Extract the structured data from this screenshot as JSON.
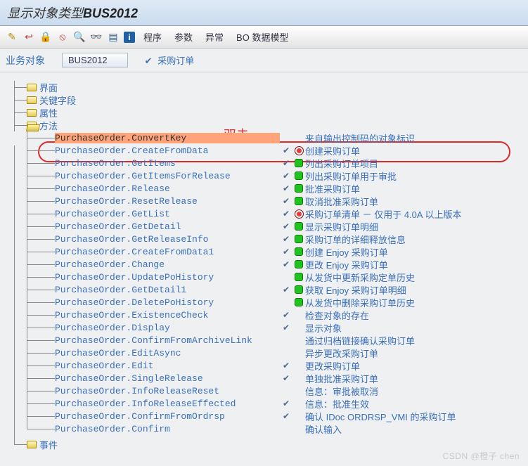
{
  "titlebar": {
    "prefix": "显示对象类型",
    "objtype": "BUS2012"
  },
  "toolbar": {
    "icons": [
      "wand",
      "brush",
      "lock",
      "stop",
      "find",
      "findnext",
      "grid",
      "info"
    ],
    "menus": {
      "program": "程序",
      "params": "参数",
      "except": "异常",
      "bomodel": "BO 数据模型"
    }
  },
  "infobar": {
    "label": "业务对象",
    "object": "BUS2012",
    "desc": "采购订单"
  },
  "annotation": {
    "label": "双击"
  },
  "nodes": {
    "interface": "界面",
    "keyfields": "关键字段",
    "attributes": "属性",
    "methods": "方法",
    "events": "事件"
  },
  "methods": [
    {
      "name": "PurchaseOrder.ConvertKey",
      "check": false,
      "status": "",
      "desc": "来自输出控制码的对象标识",
      "highlight": true
    },
    {
      "name": "PurchaseOrder.CreateFromData",
      "check": true,
      "status": "red",
      "desc": "创建采购订单"
    },
    {
      "name": "PurchaseOrder.GetItems",
      "check": true,
      "status": "green",
      "desc": "列出采购订单项目"
    },
    {
      "name": "PurchaseOrder.GetItemsForRelease",
      "check": true,
      "status": "green",
      "desc": "列出采购订单用于审批"
    },
    {
      "name": "PurchaseOrder.Release",
      "check": true,
      "status": "green",
      "desc": "批准采购订单"
    },
    {
      "name": "PurchaseOrder.ResetRelease",
      "check": true,
      "status": "green",
      "desc": "取消批准采购订单"
    },
    {
      "name": "PurchaseOrder.GetList",
      "check": true,
      "status": "red",
      "desc": "采购订单清单 －  仅用于 4.0A 以上版本"
    },
    {
      "name": "PurchaseOrder.GetDetail",
      "check": true,
      "status": "green",
      "desc": "显示采购订单明细"
    },
    {
      "name": "PurchaseOrder.GetReleaseInfo",
      "check": true,
      "status": "green",
      "desc": "采购订单的详细释放信息"
    },
    {
      "name": "PurchaseOrder.CreateFromData1",
      "check": true,
      "status": "green",
      "desc": "创建 Enjoy 采购订单"
    },
    {
      "name": "PurchaseOrder.Change",
      "check": true,
      "status": "green",
      "desc": "更改 Enjoy 采购订单"
    },
    {
      "name": "PurchaseOrder.UpdatePoHistory",
      "check": false,
      "status": "green",
      "desc": "从发货中更新采购定单历史"
    },
    {
      "name": "PurchaseOrder.GetDetail1",
      "check": true,
      "status": "green",
      "desc": "获取 Enjoy 采购订单明细"
    },
    {
      "name": "PurchaseOrder.DeletePoHistory",
      "check": false,
      "status": "green",
      "desc": "从发货中删除采购订单历史"
    },
    {
      "name": "PurchaseOrder.ExistenceCheck",
      "check": true,
      "status": "",
      "desc": "检查对象的存在"
    },
    {
      "name": "PurchaseOrder.Display",
      "check": true,
      "status": "",
      "desc": "显示对象"
    },
    {
      "name": "PurchaseOrder.ConfirmFromArchiveLink",
      "check": false,
      "status": "",
      "desc": "通过归档链接确认采购订单"
    },
    {
      "name": "PurchaseOrder.EditAsync",
      "check": false,
      "status": "",
      "desc": "异步更改采购订单"
    },
    {
      "name": "PurchaseOrder.Edit",
      "check": true,
      "status": "",
      "desc": "更改采购订单"
    },
    {
      "name": "PurchaseOrder.SingleRelease",
      "check": true,
      "status": "",
      "desc": "单独批准采购订单"
    },
    {
      "name": "PurchaseOrder.InfoReleaseReset",
      "check": false,
      "status": "",
      "desc": "信息：审批被取消"
    },
    {
      "name": "PurchaseOrder.InfoReleaseEffected",
      "check": true,
      "status": "",
      "desc": "信息：批准生效"
    },
    {
      "name": "PurchaseOrder.ConfirmFromOrdrsp",
      "check": true,
      "status": "",
      "desc": "确认 IDoc ORDRSP_VMI 的采购订单"
    },
    {
      "name": "PurchaseOrder.Confirm",
      "check": false,
      "status": "",
      "desc": "确认输入"
    }
  ],
  "watermark": "CSDN @橙子 chen"
}
